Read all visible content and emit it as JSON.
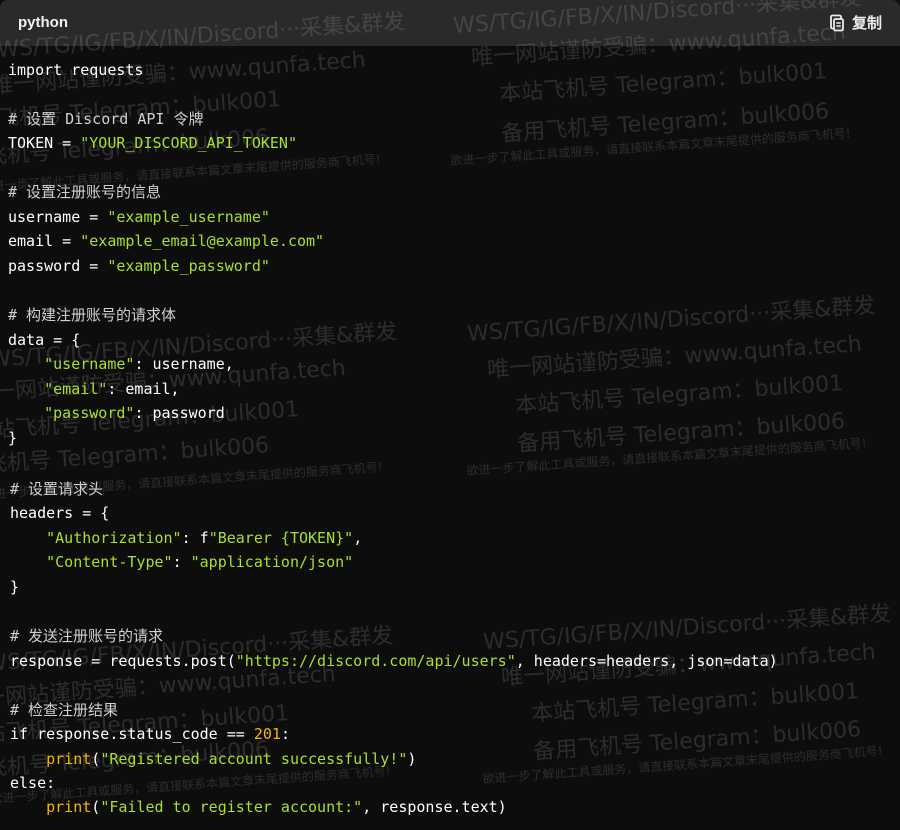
{
  "header": {
    "language": "python",
    "copy_label": "复制"
  },
  "code_lines": [
    "import requests",
    "# 设置 Discord API 令牌",
    "TOKEN = \"YOUR_DISCORD_API_TOKEN\"",
    "# 设置注册账号的信息",
    "username = \"example_username\"",
    "email = \"example_email@example.com\"",
    "password = \"example_password\"",
    "# 构建注册账号的请求体",
    "data = {",
    "    \"username\": username,",
    "    \"email\": email,",
    "    \"password\": password",
    "}",
    "# 设置请求头",
    "headers = {",
    "    \"Authorization\": f\"Bearer {TOKEN}\",",
    "    \"Content-Type\": \"application/json\"",
    "}",
    "# 发送注册账号的请求",
    "response = requests.post(\"https://discord.com/api/users\", headers=headers, json=data)",
    "# 检查注册结果",
    "if response.status_code == 201:",
    "    print(\"Registered account successfully!\")",
    "else:",
    "    print(\"Failed to register account:\", response.text)"
  ],
  "watermark": {
    "line1": "WS/TG/IG/FB/X/IN/Discord···采集&群发",
    "line2": "唯一网站谨防受骗：www.qunfa.tech",
    "line3": "本站飞机号 Telegram：bulk001",
    "line4": "备用飞机号 Telegram：bulk006",
    "line5": "欲进一步了解此工具或服务，请直接联系本篇文章末尾提供的服务商飞机号!"
  },
  "colors": {
    "background": "#0d0d0d",
    "header": "#2a2a2a",
    "string": "#a8e02a",
    "number": "#f5b800",
    "builtin": "#f5b800",
    "comment": "#d0d0d0",
    "text": "#ffffff"
  }
}
